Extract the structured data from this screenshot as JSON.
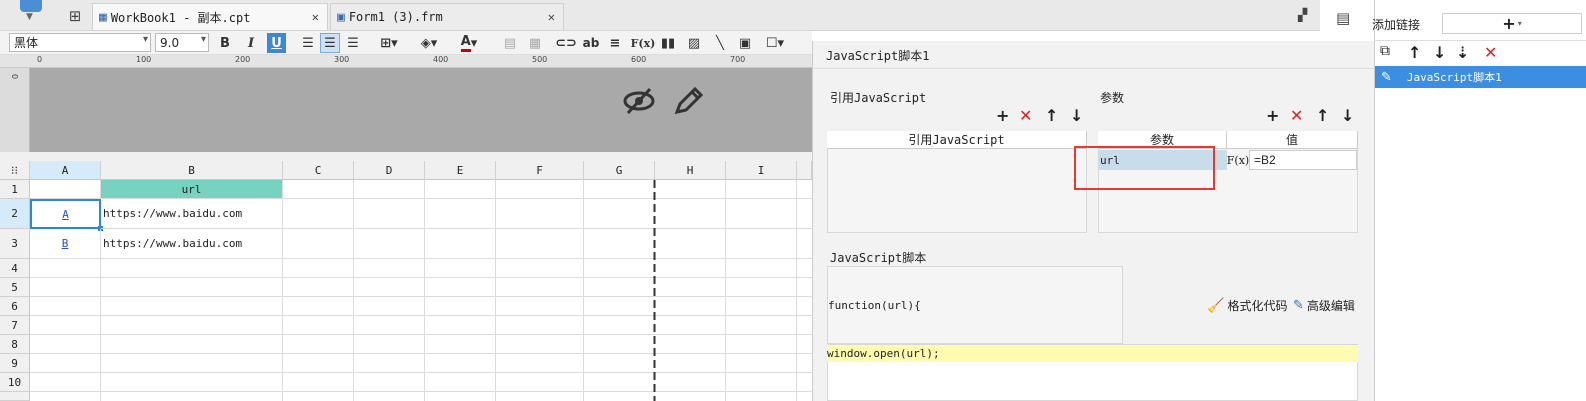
{
  "tabs": [
    {
      "label": "WorkBook1 - 副本.cpt",
      "active": true
    },
    {
      "label": "Form1 (3).frm",
      "active": false
    }
  ],
  "toolbar": {
    "font_name": "黑体",
    "font_size": "9.0",
    "bold": "B",
    "italic": "I",
    "underline": "U",
    "text_label": "ab",
    "formula": "F(x)"
  },
  "ruler": {
    "marks": [
      "0",
      "100",
      "200",
      "300",
      "400",
      "500",
      "600",
      "700"
    ]
  },
  "sheet": {
    "columns": [
      "A",
      "B",
      "C",
      "D",
      "E",
      "F",
      "G",
      "H",
      "I"
    ],
    "rows": [
      "1",
      "2",
      "3",
      "4",
      "5",
      "6",
      "7",
      "8",
      "9",
      "10"
    ],
    "b1": "url",
    "a2": "A",
    "b2": "https://www.baidu.com",
    "a3": "B",
    "b3": "https://www.baidu.com"
  },
  "dialog": {
    "title": "JavaScript脚本1",
    "ref_js_section": "引用JavaScript",
    "ref_js_header": "引用JavaScript",
    "params_section": "参数",
    "params_header_name": "参数",
    "params_header_value": "值",
    "param_name": "url",
    "param_value": "=B2",
    "param_fx": "F(x)",
    "script_section": "JavaScript脚本",
    "function_sig": "function(url){",
    "format_code": "格式化代码",
    "advanced_edit": "高级编辑",
    "code_line": "window.open(url);"
  },
  "right": {
    "add_link": "添加链接",
    "add_button": "+",
    "list_item": "JavaScript脚本1"
  },
  "colors": {
    "header_green": "#77d3bf",
    "selection_blue": "#2b88d8",
    "red_highlight": "#e53935",
    "code_yellow": "#fffbb0"
  }
}
